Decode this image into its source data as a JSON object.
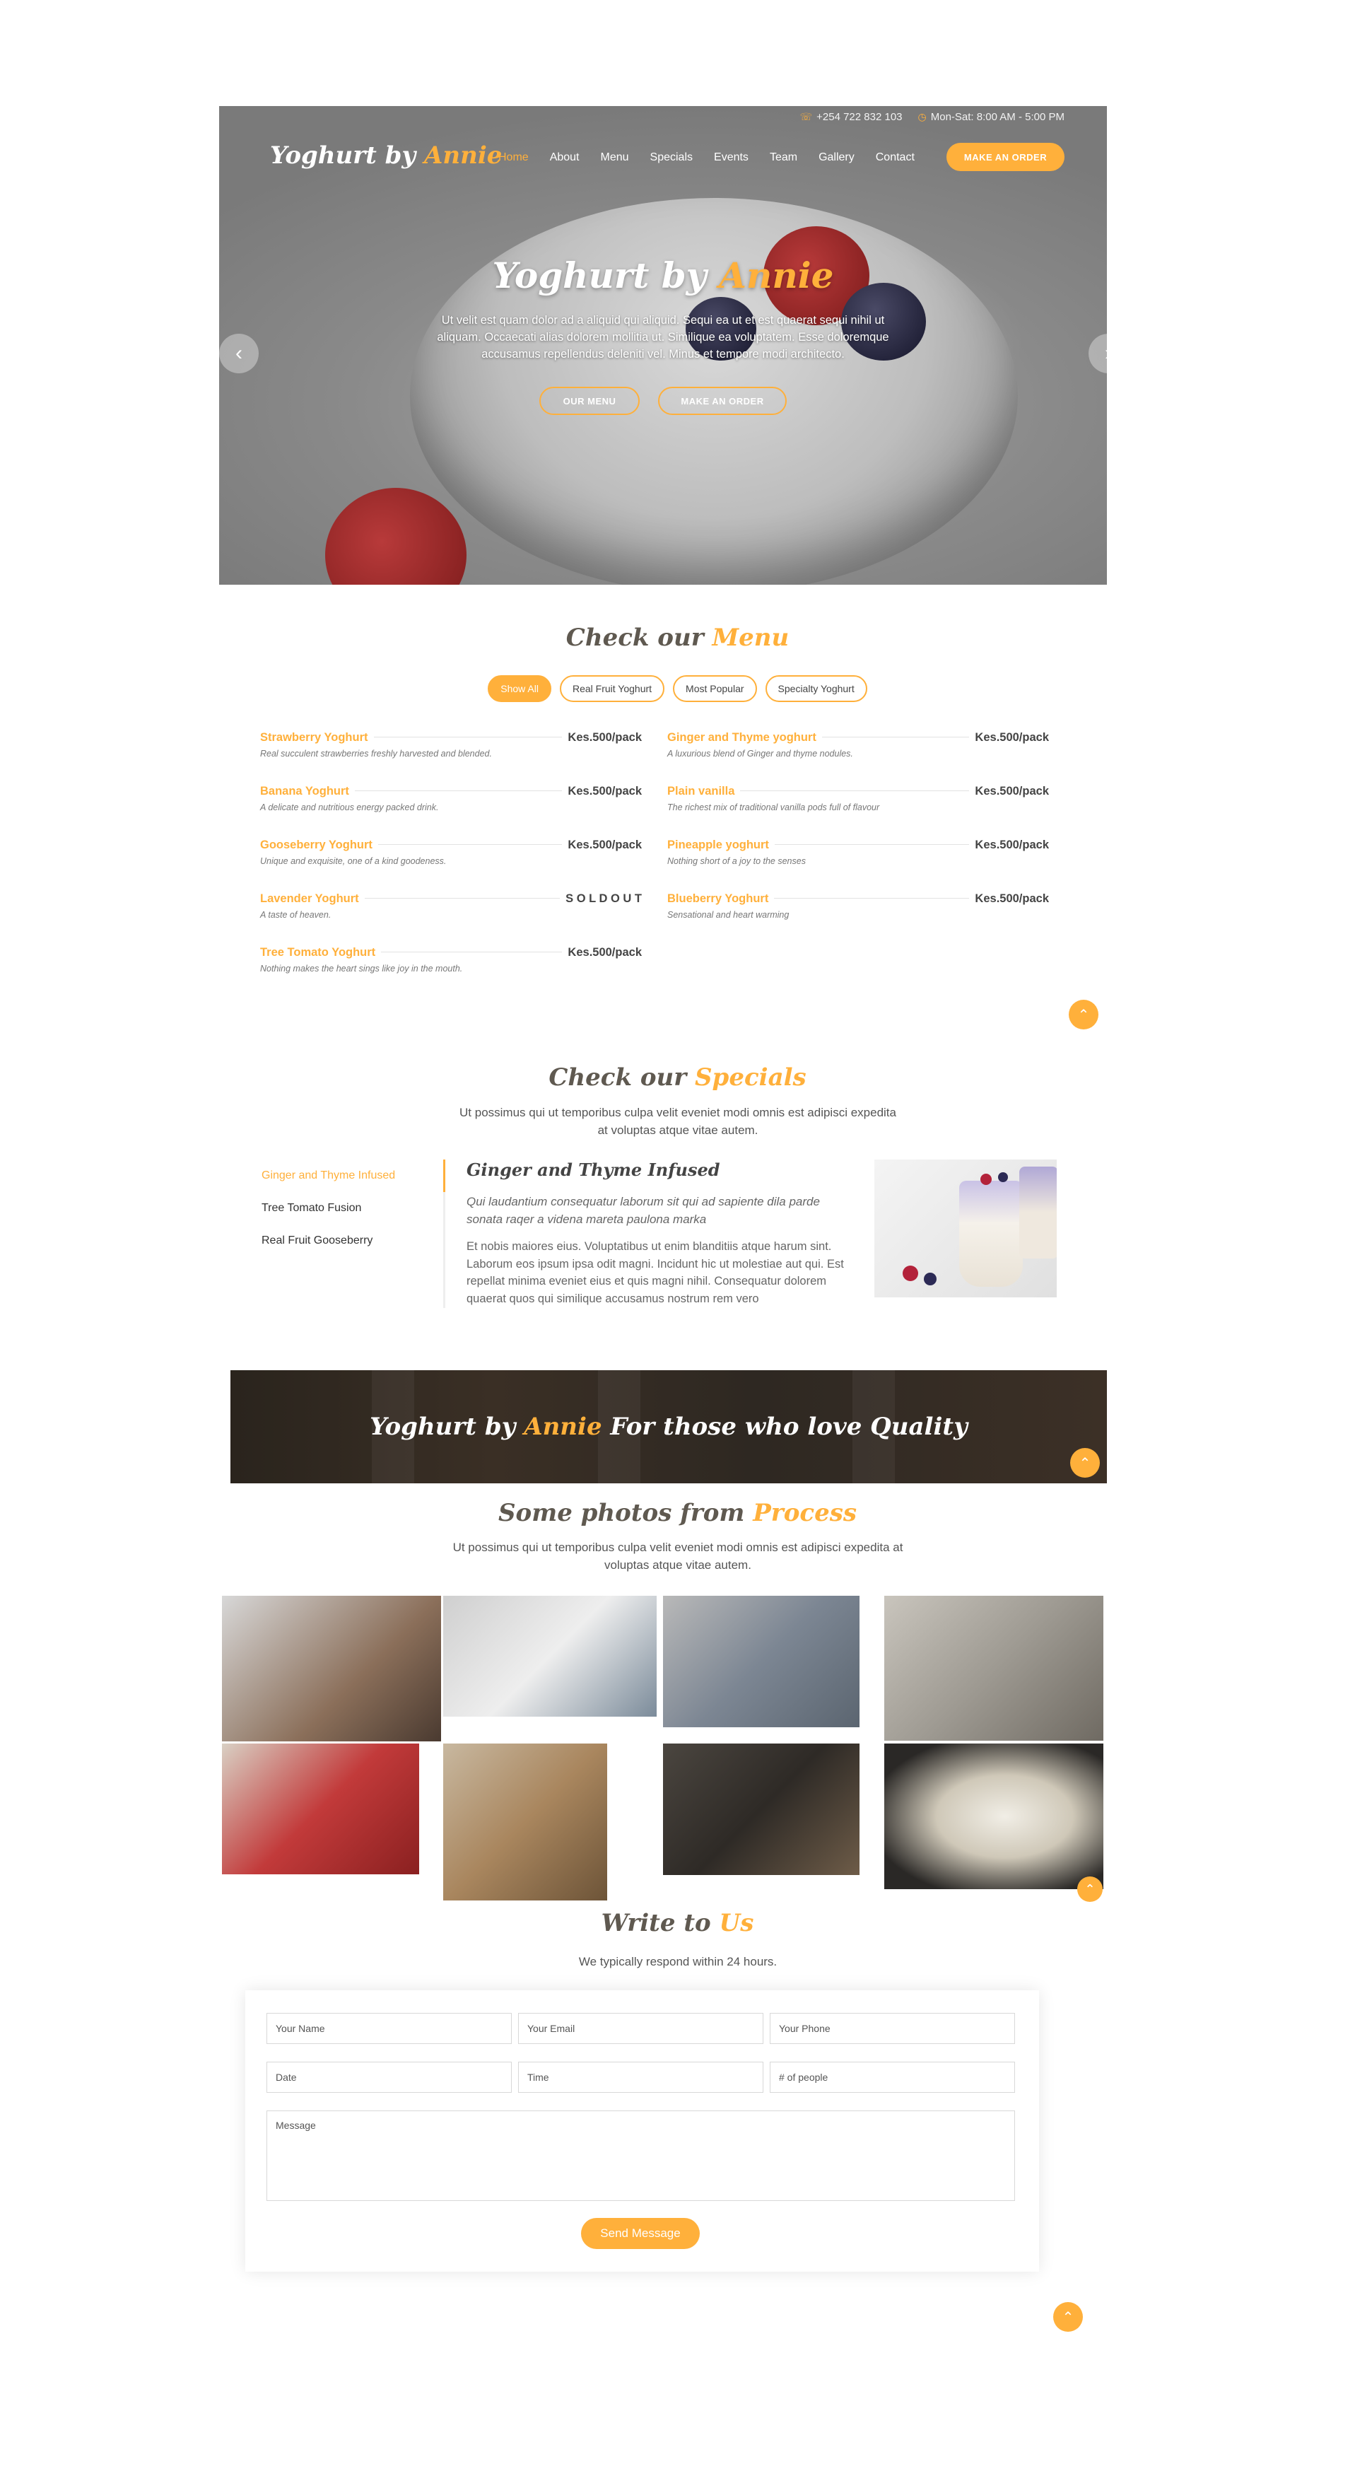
{
  "topbar": {
    "phone": "+254 722 832 103",
    "hours": "Mon-Sat: 8:00 AM - 5:00 PM"
  },
  "brand": {
    "name_plain": "Yoghurt by",
    "name_accent": "Annie"
  },
  "nav": {
    "items": [
      "Home",
      "About",
      "Menu",
      "Specials",
      "Events",
      "Team",
      "Gallery",
      "Contact"
    ],
    "cta": "MAKE AN ORDER"
  },
  "hero": {
    "title_plain": "Yoghurt by",
    "title_accent": "Annie",
    "description": "Ut velit est quam dolor ad a aliquid qui aliquid. Sequi ea ut et est quaerat sequi nihil ut aliquam. Occaecati alias dolorem mollitia ut. Similique ea voluptatem. Esse doloremque accusamus repellendus deleniti vel. Minus et tempore modi architecto.",
    "btn_menu": "OUR MENU",
    "btn_order": "MAKE AN ORDER",
    "prev_icon": "chevron-left-icon",
    "next_icon": "chevron-right-icon"
  },
  "menu": {
    "title_plain": "Check our",
    "title_accent": "Menu",
    "filters": [
      "Show All",
      "Real Fruit Yoghurt",
      "Most Popular",
      "Specialty Yoghurt"
    ],
    "items": [
      {
        "name": "Strawberry Yoghurt",
        "price": "Kes.500/pack",
        "desc": "Real succulent strawberries freshly harvested and blended."
      },
      {
        "name": "Ginger and Thyme yoghurt",
        "price": "Kes.500/pack",
        "desc": "A luxurious blend of Ginger and thyme nodules."
      },
      {
        "name": "Banana Yoghurt",
        "price": "Kes.500/pack",
        "desc": "A delicate and nutritious energy packed drink."
      },
      {
        "name": "Plain vanilla",
        "price": "Kes.500/pack",
        "desc": "The richest mix of traditional vanilla pods full of flavour"
      },
      {
        "name": "Gooseberry Yoghurt",
        "price": "Kes.500/pack",
        "desc": "Unique and exquisite, one of a kind goodeness."
      },
      {
        "name": "Pineapple yoghurt",
        "price": "Kes.500/pack",
        "desc": "Nothing short of a joy to the senses"
      },
      {
        "name": "Lavender Yoghurt",
        "price": "S O L D O U T",
        "desc": "A taste of heaven."
      },
      {
        "name": "Blueberry Yoghurt",
        "price": "Kes.500/pack",
        "desc": "Sensational and heart warming"
      },
      {
        "name": "Tree Tomato Yoghurt",
        "price": "Kes.500/pack",
        "desc": "Nothing makes the heart sings like joy in the mouth."
      }
    ]
  },
  "specials": {
    "title_plain": "Check our",
    "title_accent": "Specials",
    "subtitle": "Ut possimus qui ut temporibus culpa velit eveniet modi omnis est adipisci expedita at voluptas atque vitae autem.",
    "tabs": [
      "Ginger and Thyme Infused",
      "Tree Tomato Fusion",
      "Real Fruit Gooseberry"
    ],
    "detail_title": "Ginger and Thyme Infused",
    "detail_lead": "Qui laudantium consequatur laborum sit qui ad sapiente dila parde sonata raqer a videna mareta paulona marka",
    "detail_body": "Et nobis maiores eius. Voluptatibus ut enim blanditiis atque harum sint. Laborum eos ipsum ipsa odit magni. Incidunt hic ut molestiae aut qui. Est repellat minima eveniet eius et quis magni nihil. Consequatur dolorem quaerat quos qui similique accusamus nostrum rem vero"
  },
  "banner": {
    "plain1": "Yoghurt by",
    "accent": "Annie",
    "plain2": "For those who love Quality"
  },
  "gallery": {
    "title_plain": "Some photos from",
    "title_accent": "Process",
    "subtitle": "Ut possimus qui ut temporibus culpa velit eveniet modi omnis est adipisci expedita at voluptas atque vitae autem."
  },
  "contact": {
    "title_plain": "Write to",
    "title_accent": "Us",
    "subtitle": "We typically respond within 24 hours.",
    "placeholders": {
      "name": "Your Name",
      "email": "Your Email",
      "phone": "Your Phone",
      "date": "Date",
      "time": "Time",
      "people": "# of people",
      "message": "Message"
    },
    "send": "Send Message"
  },
  "icons": {
    "phone": "phone-icon",
    "clock": "clock-icon",
    "back_to_top": "chevron-up-icon"
  },
  "colors": {
    "accent": "#ffb03b",
    "text": "#444444",
    "title": "#5f5950"
  }
}
